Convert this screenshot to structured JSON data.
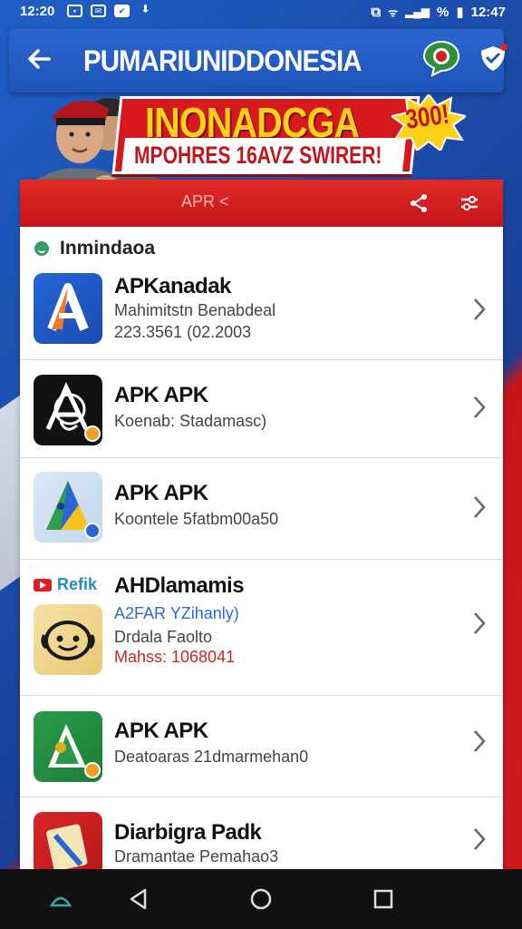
{
  "status_bar": {
    "time": "12:20",
    "right_time": "12:47",
    "battery": "%"
  },
  "app_bar": {
    "title": "PUMARIUNIDDONESIA"
  },
  "banner": {
    "headline": "INONADCGA",
    "subline": "MPOHRES 16AVZ SWIRER!",
    "burst": "300!"
  },
  "card": {
    "tab_label": "APR <",
    "section_title": "Inmindaoa"
  },
  "apps": [
    {
      "title": "APKanadak",
      "lines": [
        "Mahimitstn Benabdeal",
        "223.3561 (02.2003"
      ],
      "icon": "apk-a-icon"
    },
    {
      "title": "APK APK",
      "lines": [
        "Koenab: Stadamasc)"
      ],
      "icon": "apk-graffiti-icon"
    },
    {
      "title": "APK APK",
      "lines": [
        "Koontele 5fatbm00a50"
      ],
      "icon": "apk-maps-icon"
    },
    {
      "title": "AHDlamamis",
      "category": "Refik",
      "lines": [
        "A2FAR YZihanly)",
        "Drdala Faolto",
        "Mahss: 1068041"
      ],
      "icon": "smiley-face-icon"
    },
    {
      "title": "APK APK",
      "lines": [
        "Deatoaras 21dmarmehan0"
      ],
      "icon": "apk-green-icon"
    },
    {
      "title": "Diarbigra Padk",
      "lines": [
        "Dramantae Pemahao3"
      ],
      "icon": "apk-red-icon"
    }
  ],
  "colors": {
    "primary_blue": "#1e54b8",
    "accent_red": "#d7191d",
    "promo_yellow": "#ffd21a"
  }
}
